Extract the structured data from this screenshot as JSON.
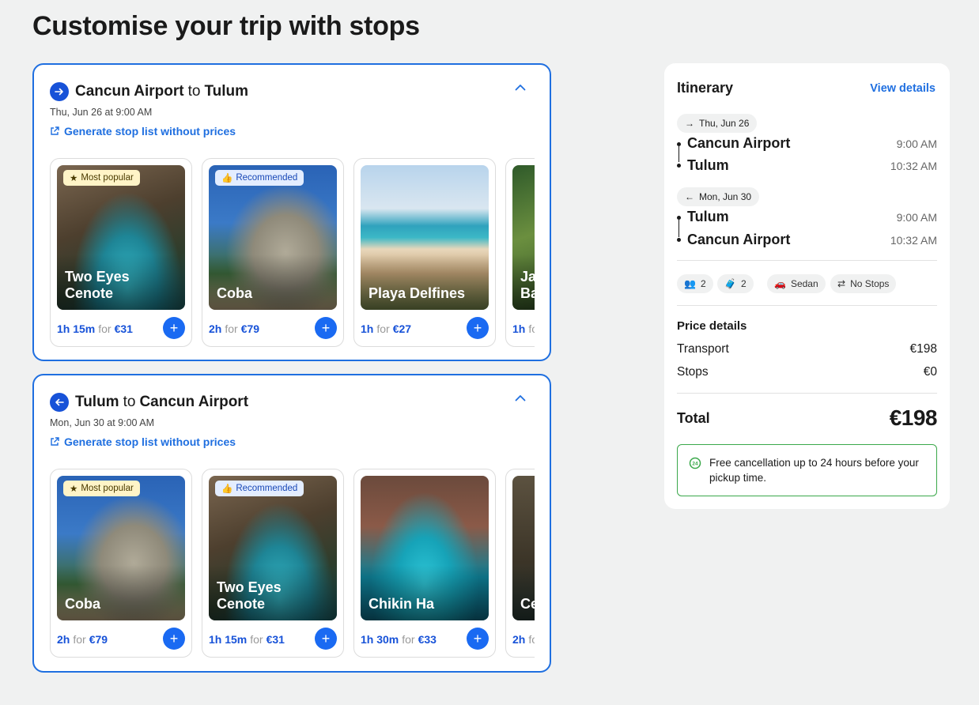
{
  "page_title": "Customise your trip with stops",
  "legs": [
    {
      "direction": "outbound",
      "from": "Cancun Airport",
      "connector": "to",
      "to": "Tulum",
      "date": "Thu, Jun 26 at 9:00 AM",
      "generate_link": "Generate stop list without prices",
      "cards": [
        {
          "badge": "Most popular",
          "name": "Two Eyes Cenote",
          "duration": "1h 15m",
          "for": "for",
          "price": "€31"
        },
        {
          "badge": "Recommended",
          "name": "Coba",
          "duration": "2h",
          "for": "for",
          "price": "€79"
        },
        {
          "badge": "",
          "name": "Playa Delfines",
          "duration": "1h",
          "for": "for",
          "price": "€27"
        },
        {
          "badge": "",
          "name": "Jaguar Dreams Bay",
          "duration": "1h",
          "for": "for",
          "price": ""
        }
      ]
    },
    {
      "direction": "inbound",
      "from": "Tulum",
      "connector": "to",
      "to": "Cancun Airport",
      "date": "Mon, Jun 30 at 9:00 AM",
      "generate_link": "Generate stop list without prices",
      "cards": [
        {
          "badge": "Most popular",
          "name": "Coba",
          "duration": "2h",
          "for": "for",
          "price": "€79"
        },
        {
          "badge": "Recommended",
          "name": "Two Eyes Cenote",
          "duration": "1h 15m",
          "for": "for",
          "price": "€31"
        },
        {
          "badge": "",
          "name": "Chikin Ha",
          "duration": "1h 30m",
          "for": "for",
          "price": "€33"
        },
        {
          "badge": "",
          "name": "Cenote Tulum",
          "duration": "2h",
          "for": "for",
          "price": ""
        }
      ]
    }
  ],
  "itinerary": {
    "title": "Itinerary",
    "view_details": "View details",
    "outbound": {
      "date": "Thu, Jun 26",
      "stops": [
        {
          "name": "Cancun Airport",
          "time": "9:00 AM"
        },
        {
          "name": "Tulum",
          "time": "10:32 AM"
        }
      ]
    },
    "inbound": {
      "date": "Mon, Jun 30",
      "stops": [
        {
          "name": "Tulum",
          "time": "9:00 AM"
        },
        {
          "name": "Cancun Airport",
          "time": "10:32 AM"
        }
      ]
    },
    "features": {
      "passengers": "2",
      "luggage": "2",
      "vehicle": "Sedan",
      "stops": "No Stops"
    },
    "price_details": {
      "title": "Price details",
      "transport_label": "Transport",
      "transport_value": "€198",
      "stops_label": "Stops",
      "stops_value": "€0"
    },
    "total": {
      "label": "Total",
      "value": "€198"
    },
    "cancellation": "Free cancellation up to 24 hours before your pickup time."
  },
  "colors": {
    "accent": "#1f6fe0",
    "add_button": "#1a6af2",
    "cancellation_border": "#3aa84a",
    "popular_badge_bg": "#fff4c7",
    "recommended_badge_bg": "#e3edff"
  }
}
